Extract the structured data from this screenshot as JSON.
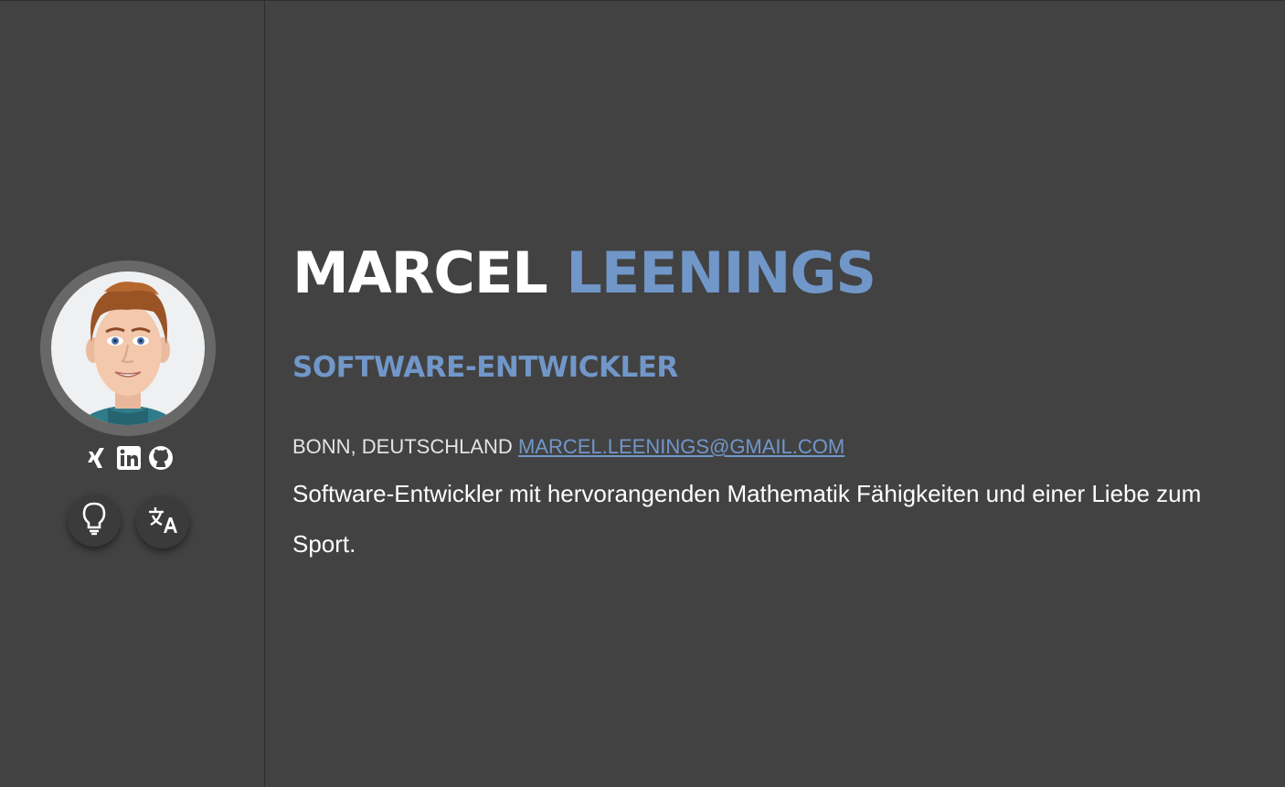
{
  "sidebar": {
    "avatar_alt": "Avatar",
    "social": [
      {
        "name": "xing",
        "icon": "xing-icon"
      },
      {
        "name": "linkedin",
        "icon": "linkedin-icon"
      },
      {
        "name": "github",
        "icon": "github-icon"
      }
    ],
    "buttons": [
      {
        "name": "theme-toggle",
        "icon": "lightbulb-icon"
      },
      {
        "name": "language-toggle",
        "icon": "translate-icon"
      }
    ]
  },
  "header": {
    "first_name": "MARCEL",
    "last_name": "LEENINGS",
    "role": "SOFTWARE-ENTWICKLER"
  },
  "contact": {
    "location": "BONN, DEUTSCHLAND",
    "email": "MARCEL.LEENINGS@GMAIL.COM"
  },
  "about": {
    "description": "Software-Entwickler mit hervorangenden Mathematik Fähigkeiten und einer Liebe zum Sport."
  },
  "colors": {
    "background": "#424242",
    "accent": "#7197c9",
    "text": "#ffffff"
  }
}
